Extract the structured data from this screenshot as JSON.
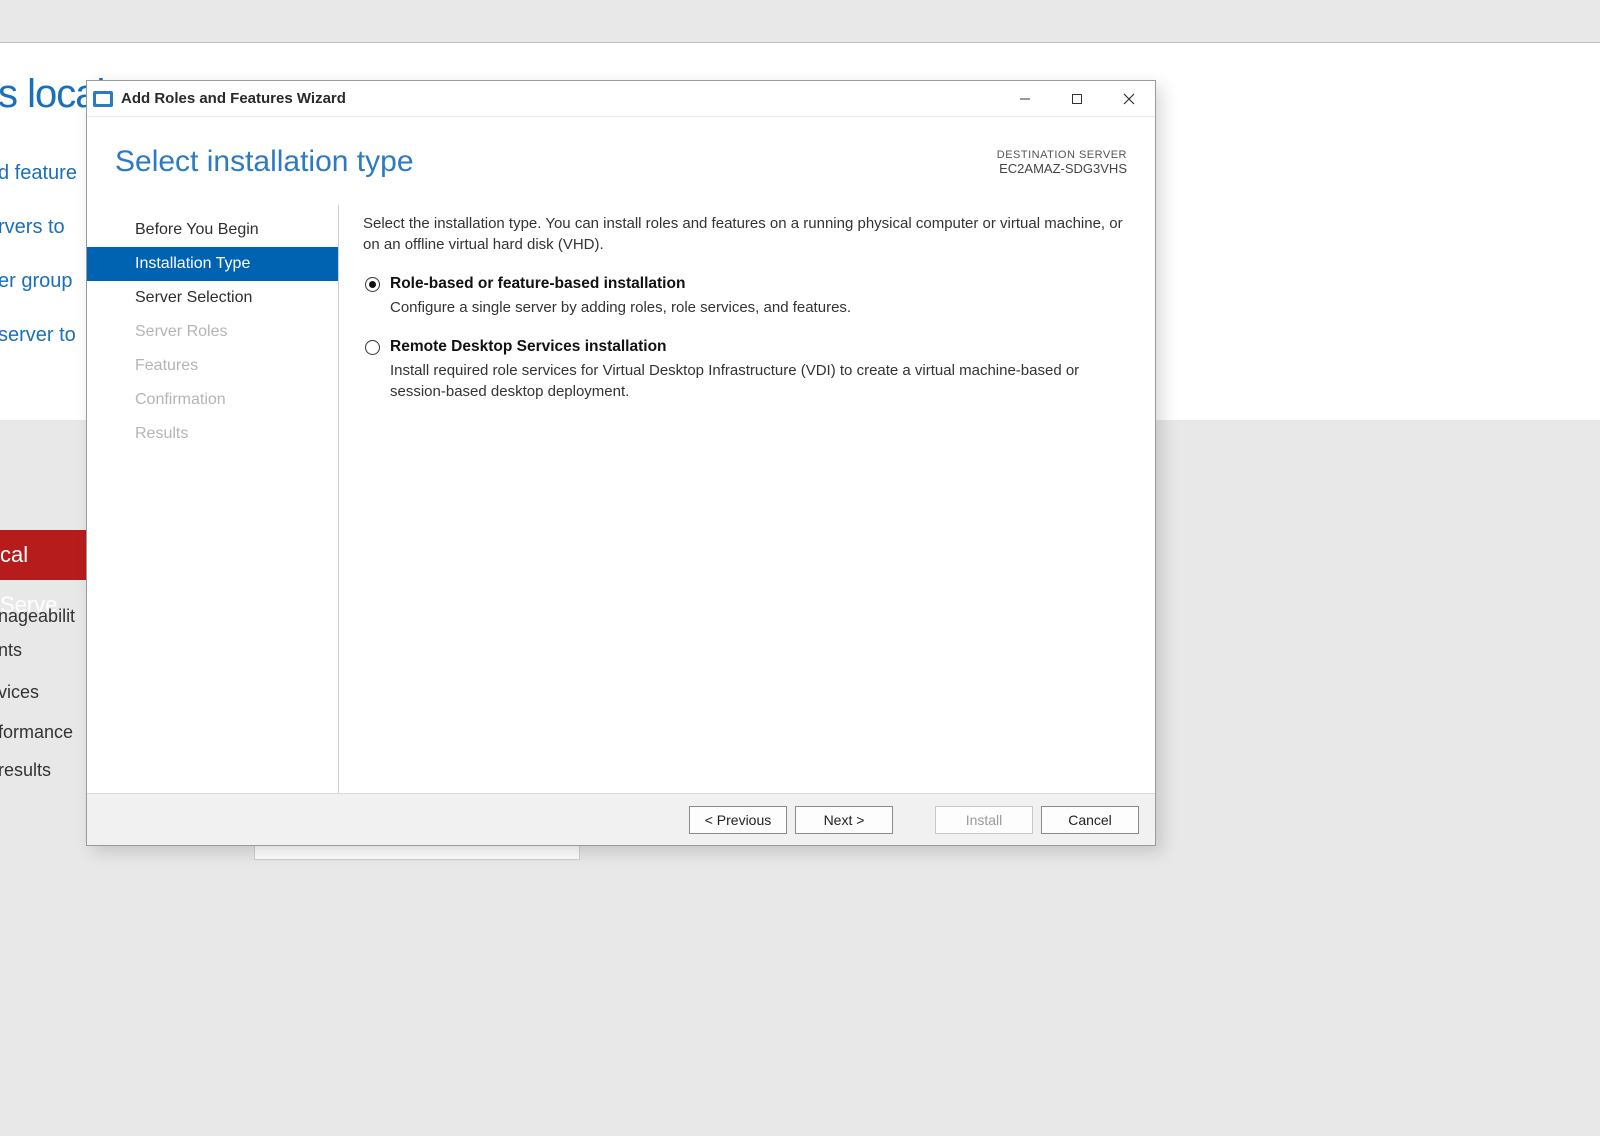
{
  "bg": {
    "big": "s local",
    "l1": "d feature",
    "l2": "rvers to",
    "l3": "er group",
    "l4": "server to",
    "red": "cal Serve",
    "i1": "nageabilit",
    "i2": "nts",
    "i3": "vices",
    "i4": "formance",
    "i5": "results"
  },
  "dialog": {
    "title": "Add Roles and Features Wizard",
    "heading": "Select installation type",
    "dest_label": "DESTINATION SERVER",
    "dest_server": "EC2AMAZ-SDG3VHS",
    "nav": {
      "n0": "Before You Begin",
      "n1": "Installation Type",
      "n2": "Server Selection",
      "n3": "Server Roles",
      "n4": "Features",
      "n5": "Confirmation",
      "n6": "Results"
    },
    "intro": "Select the installation type. You can install roles and features on a running physical computer or virtual machine, or on an offline virtual hard disk (VHD).",
    "options": {
      "o0": {
        "title": "Role-based or feature-based installation",
        "desc": "Configure a single server by adding roles, role services, and features."
      },
      "o1": {
        "title": "Remote Desktop Services installation",
        "desc": "Install required role services for Virtual Desktop Infrastructure (VDI) to create a virtual machine-based or session-based desktop deployment."
      }
    },
    "buttons": {
      "prev": "< Previous",
      "next": "Next >",
      "install": "Install",
      "cancel": "Cancel"
    }
  }
}
